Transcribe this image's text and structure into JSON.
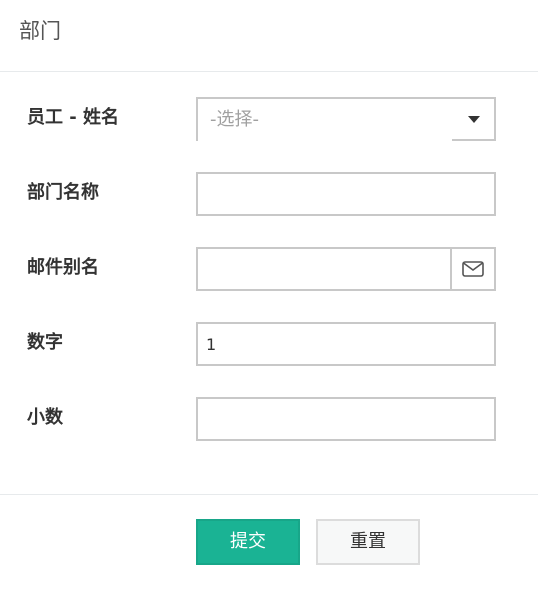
{
  "header": {
    "title": "部门"
  },
  "form": {
    "employee_name": {
      "label": "员工 - 姓名",
      "placeholder": "-选择-"
    },
    "department_name": {
      "label": "部门名称",
      "value": ""
    },
    "email_alias": {
      "label": "邮件别名",
      "value": "",
      "icon": "envelope-icon"
    },
    "number": {
      "label": "数字",
      "value": "1"
    },
    "decimal": {
      "label": "小数",
      "value": ""
    }
  },
  "actions": {
    "submit_label": "提交",
    "reset_label": "重置"
  },
  "colors": {
    "primary": "#1ab394",
    "border": "#c8c8c8",
    "label": "#333333",
    "placeholder": "#a0a0a0"
  }
}
